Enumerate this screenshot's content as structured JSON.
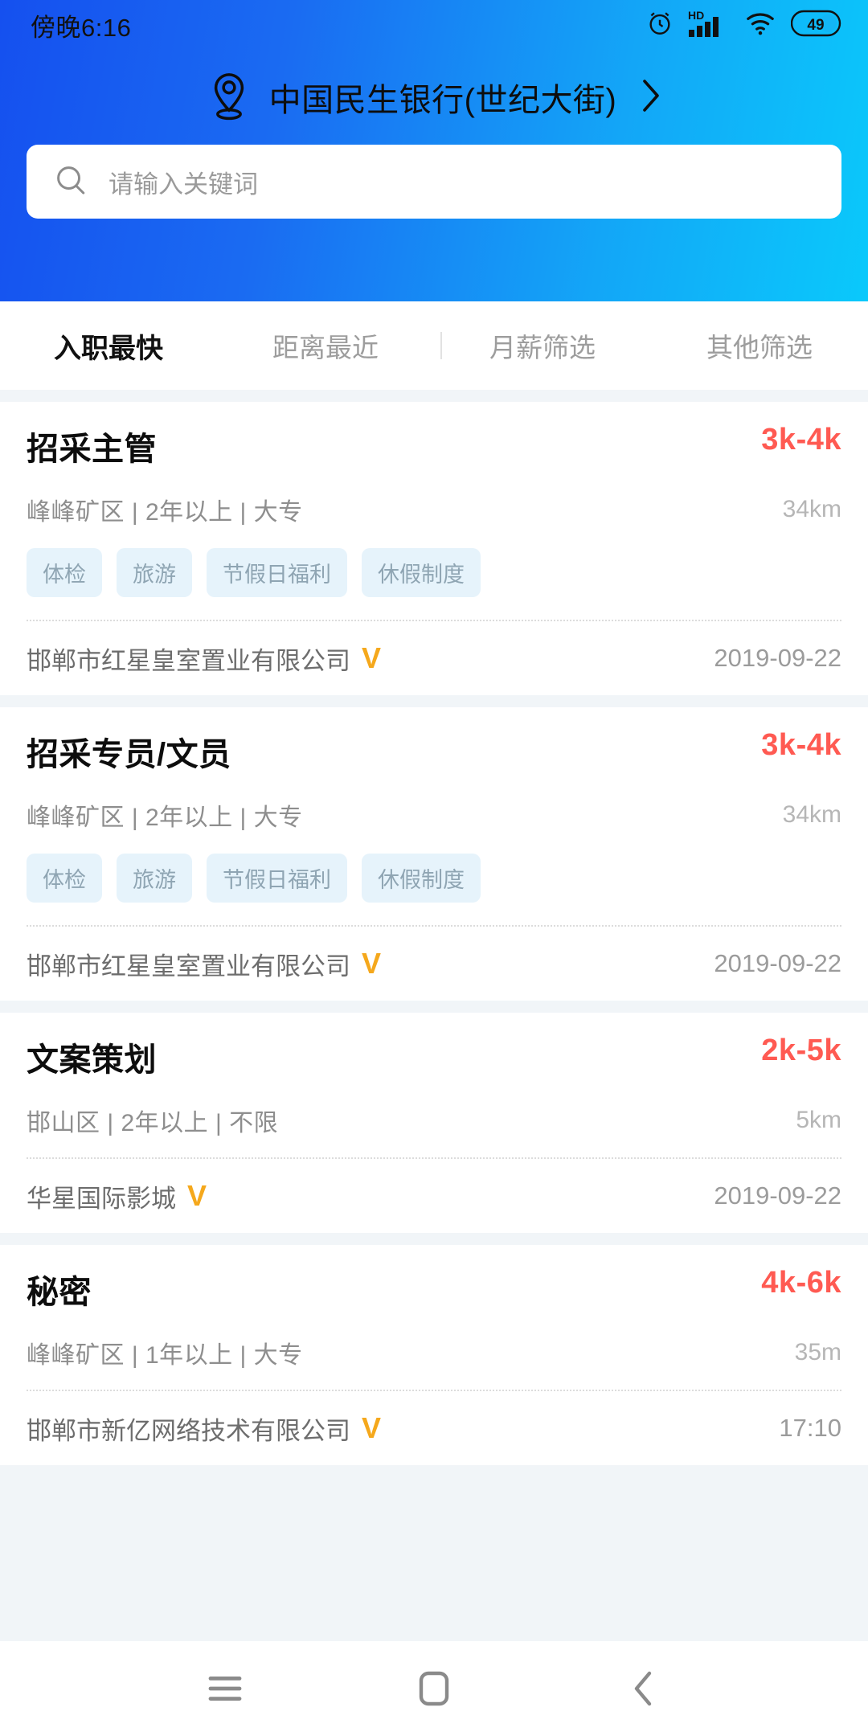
{
  "status_bar": {
    "time": "傍晚6:16",
    "battery_level": "49",
    "network_label": "HD",
    "icons": [
      "alarm-icon",
      "hd-signal-icon",
      "wifi-icon",
      "battery-icon"
    ]
  },
  "header": {
    "location_name": "中国民生银行(世纪大街)",
    "location_icon": "map-pin-icon",
    "chevron_icon": "chevron-right-icon",
    "gradient_from": "#1550ef",
    "gradient_to": "#0ac9fb"
  },
  "search": {
    "placeholder": "请输入关键词",
    "value": "",
    "icon": "search-icon"
  },
  "tabs": [
    {
      "label": "入职最快",
      "active": true
    },
    {
      "label": "距离最近",
      "active": false
    },
    {
      "label": "月薪筛选",
      "active": false
    },
    {
      "label": "其他筛选",
      "active": false
    }
  ],
  "colors": {
    "salary": "#ff5a52",
    "verified_badge": "#f5a81c",
    "tag_bg": "#e6f3fb",
    "tag_text": "#8fa5b3",
    "list_bg": "#f1f5f8"
  },
  "jobs": [
    {
      "title": "招采主管",
      "salary": "3k-4k",
      "meta": "峰峰矿区 | 2年以上 | 大专",
      "distance": "34km",
      "tags": [
        "体检",
        "旅游",
        "节假日福利",
        "休假制度"
      ],
      "company": "邯郸市红星皇室置业有限公司",
      "verified": "V",
      "date": "2019-09-22"
    },
    {
      "title": "招采专员/文员",
      "salary": "3k-4k",
      "meta": "峰峰矿区 | 2年以上 | 大专",
      "distance": "34km",
      "tags": [
        "体检",
        "旅游",
        "节假日福利",
        "休假制度"
      ],
      "company": "邯郸市红星皇室置业有限公司",
      "verified": "V",
      "date": "2019-09-22"
    },
    {
      "title": "文案策划",
      "salary": "2k-5k",
      "meta": "邯山区 | 2年以上 | 不限",
      "distance": "5km",
      "tags": [],
      "company": "华星国际影城",
      "verified": "V",
      "date": "2019-09-22"
    },
    {
      "title": "秘密",
      "salary": "4k-6k",
      "meta": "峰峰矿区 | 1年以上 | 大专",
      "distance": "35m",
      "tags": [],
      "company": "邯郸市新亿网络技术有限公司",
      "verified": "V",
      "date": "17:10"
    }
  ],
  "navbar": {
    "recents_icon": "menu-icon",
    "home_icon": "home-square-icon",
    "back_icon": "chevron-left-icon"
  }
}
